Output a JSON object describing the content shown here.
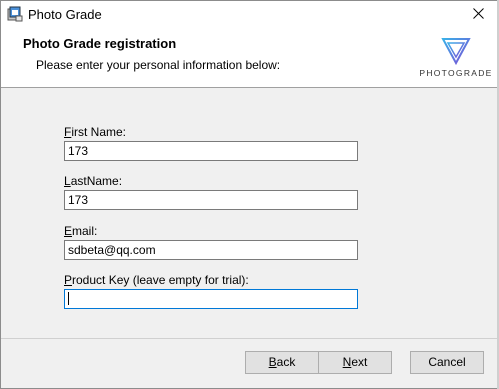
{
  "window": {
    "title": "Photo Grade",
    "close_symbol": "✕"
  },
  "header": {
    "title": "Photo Grade registration",
    "subtitle": "Please enter your personal information below:",
    "logo_text": "PHOTOGRADE"
  },
  "form": {
    "first_name": {
      "label_mnemonic": "F",
      "label_rest": "irst Name:",
      "value": "173"
    },
    "last_name": {
      "label_mnemonic": "L",
      "label_rest": "astName:",
      "value": "173"
    },
    "email": {
      "label_mnemonic": "E",
      "label_rest": "mail:",
      "value": "sdbeta@qq.com"
    },
    "product_key": {
      "label_mnemonic": "P",
      "label_rest": "roduct Key (leave empty for trial):",
      "value": ""
    }
  },
  "buttons": {
    "back": {
      "mnemonic": "B",
      "rest": "ack"
    },
    "next": {
      "mnemonic": "N",
      "rest": "ext"
    },
    "cancel": "Cancel"
  },
  "icons": {
    "app": "photo-grade-app-icon",
    "close": "close-icon",
    "logo": "photograde-logo-icon"
  },
  "colors": {
    "dialog_bg": "#f0f0f0",
    "focus_border": "#0078d7",
    "logo_gradient_start": "#3ab0e8",
    "logo_gradient_end": "#7a4fd6"
  }
}
